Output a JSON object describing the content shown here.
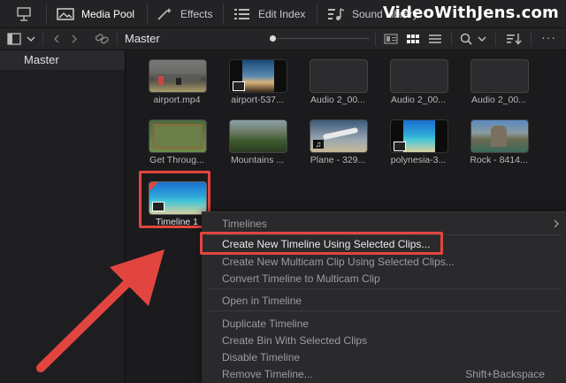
{
  "toolbar": {
    "media_pool": "Media Pool",
    "effects": "Effects",
    "edit_index": "Edit Index",
    "sound_library": "Sound Library",
    "brand": "VideoWithJens.com"
  },
  "subbar": {
    "bin_name": "Master"
  },
  "sidebar": {
    "master": "Master"
  },
  "clips": [
    {
      "name": "airport.mp4"
    },
    {
      "name": "airport-537..."
    },
    {
      "name": "Audio 2_00..."
    },
    {
      "name": "Audio 2_00..."
    },
    {
      "name": "Audio 2_00..."
    },
    {
      "name": "Get Throug..."
    },
    {
      "name": "Mountains ..."
    },
    {
      "name": "Plane - 329..."
    },
    {
      "name": "polynesia-3..."
    },
    {
      "name": "Rock - 8414..."
    },
    {
      "name": "Timeline 1"
    }
  ],
  "menu": {
    "timelines": "Timelines",
    "create_new_timeline": "Create New Timeline Using Selected Clips...",
    "create_multicam": "Create New Multicam Clip Using Selected Clips...",
    "convert_multicam": "Convert Timeline to Multicam Clip",
    "open_in_timeline": "Open in Timeline",
    "duplicate_timeline": "Duplicate Timeline",
    "create_bin": "Create Bin With Selected Clips",
    "disable_timeline": "Disable Timeline",
    "remove_timeline": "Remove Timeline...",
    "remove_shortcut": "Shift+Backspace"
  },
  "colors": {
    "accent_red": "#e2453f",
    "background": "#1c1c1e"
  }
}
